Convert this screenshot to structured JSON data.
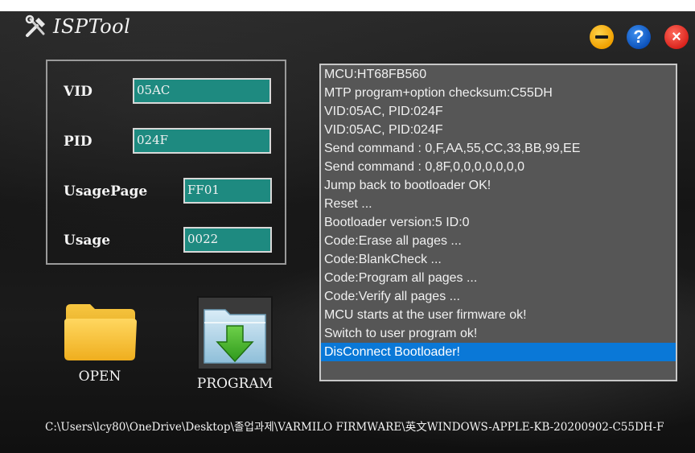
{
  "app": {
    "title": "ISPTool"
  },
  "window_controls": {
    "minimize_icon": "minus-circle",
    "help_glyph": "?",
    "close_glyph": "×"
  },
  "params": {
    "vid": {
      "label": "VID",
      "value": "05AC"
    },
    "pid": {
      "label": "PID",
      "value": "024F"
    },
    "usage_page": {
      "label": "UsagePage",
      "value": "FF01"
    },
    "usage": {
      "label": "Usage",
      "value": "0022"
    }
  },
  "actions": {
    "open": {
      "label": "OPEN",
      "icon": "folder-icon"
    },
    "program": {
      "label": "PROGRAM",
      "icon": "download-arrow-icon"
    }
  },
  "log": {
    "lines": [
      "MCU:HT68FB560",
      "MTP program+option checksum:C55DH",
      "VID:05AC, PID:024F",
      "VID:05AC, PID:024F",
      "Send command : 0,F,AA,55,CC,33,BB,99,EE",
      "Send command : 0,8F,0,0,0,0,0,0,0",
      "Jump back to bootloader OK!",
      "Reset ...",
      "Bootloader version:5 ID:0",
      "Code:Erase all pages ...",
      "Code:BlankCheck ...",
      "Code:Program all pages ...",
      "Code:Verify all pages ...",
      "MCU starts at the user firmware ok!",
      "Switch to user program ok!",
      "DisConnect Bootloader!"
    ],
    "selected_index": 15
  },
  "footer": {
    "path": "C:\\Users\\lcy80\\OneDrive\\Desktop\\졸업과제\\VARMILO FIRMWARE\\英文WINDOWS-APPLE-KB-20200902-C55DH-F"
  },
  "colors": {
    "input_bg": "#1e8a80",
    "selection": "#0a78d7",
    "minimize": "#f0a000",
    "help": "#0a4fb8",
    "close": "#d8201a"
  }
}
